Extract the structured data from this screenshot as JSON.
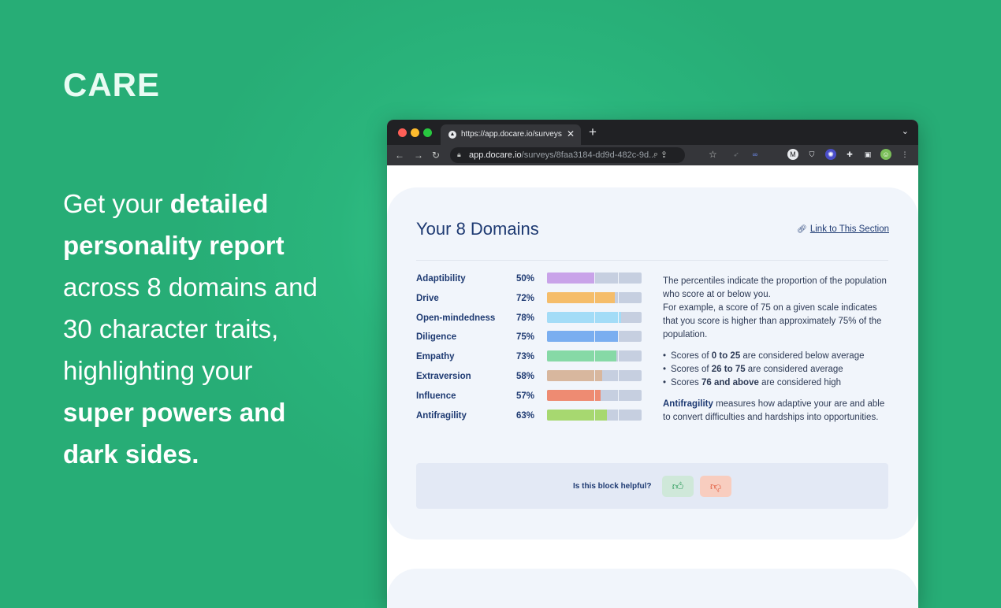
{
  "brand": "CARE",
  "headline": {
    "p1": "Get your ",
    "b1": "detailed personality report",
    "p2": " across 8 domains and 30 character traits, highlighting your ",
    "b2": "super powers and dark sides."
  },
  "browser": {
    "tab_title": "https://app.docare.io/surveys/8",
    "url_host": "app.docare.io",
    "url_path": "/surveys/8faa3184-dd9d-482c-9d..."
  },
  "section": {
    "title": "Your 8 Domains",
    "link_label": "Link to This Section",
    "domains": [
      {
        "label": "Adaptibility",
        "pct": "50%",
        "value": 50,
        "color": "#c9a3e9"
      },
      {
        "label": "Drive",
        "pct": "72%",
        "value": 72,
        "color": "#f5bd6a"
      },
      {
        "label": "Open-mindedness",
        "pct": "78%",
        "value": 78,
        "color": "#a3dcf7"
      },
      {
        "label": "Diligence",
        "pct": "75%",
        "value": 75,
        "color": "#7aaef0"
      },
      {
        "label": "Empathy",
        "pct": "73%",
        "value": 73,
        "color": "#86d9a6"
      },
      {
        "label": "Extraversion",
        "pct": "58%",
        "value": 58,
        "color": "#d8b79e"
      },
      {
        "label": "Influence",
        "pct": "57%",
        "value": 57,
        "color": "#ee8b72"
      },
      {
        "label": "Antifragility",
        "pct": "63%",
        "value": 63,
        "color": "#a7d870"
      }
    ],
    "explain_p1": "The percentiles indicate the proportion of the population who score at or below you.",
    "explain_p2": "For example, a score of 75 on a given scale indicates that you score is higher than approximately 75% of the population.",
    "bullets": [
      {
        "pre": "Scores of ",
        "bold": "0 to 25",
        "post": " are considered below average"
      },
      {
        "pre": "Scores of ",
        "bold": "26 to 75",
        "post": " are considered average"
      },
      {
        "pre": "Scores ",
        "bold": "76 and above",
        "post": " are considered high"
      }
    ],
    "note_key": "Antifragility",
    "note_text": " measures how adaptive your are and able to convert difficulties and hardships into opportunities.",
    "helpful_q": "Is this block helpful?"
  }
}
